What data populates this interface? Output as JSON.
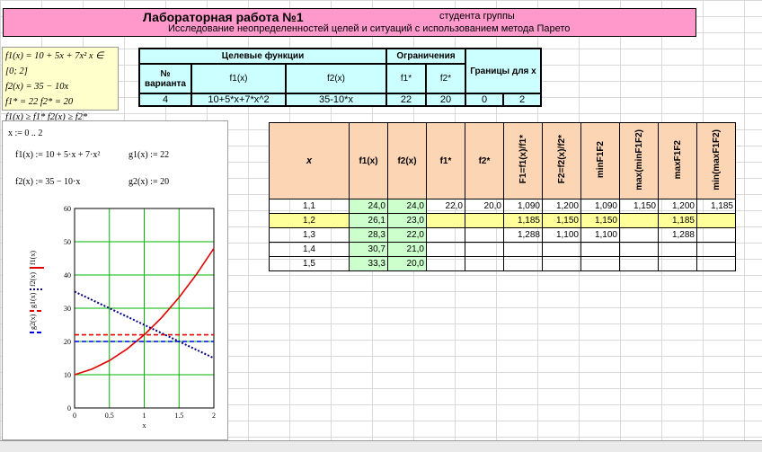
{
  "header": {
    "title": "Лабораторная работа №1",
    "student": "студента группы",
    "subtitle": "Исследование неопределенностей целей и ситуаций с использованием метода Парето"
  },
  "formulas": {
    "line1": "f1(x) = 10 + 5x + 7x²    x ∈ [0; 2]",
    "line2": "f2(x) = 35 − 10x",
    "line3": "f1* = 22    f2* = 20",
    "line4": "f1(x) ≥ f1*    f2(x) ≥ f2*"
  },
  "params": {
    "goal_header": "Целевые функции",
    "constraints_header": "Ограничения",
    "bounds_header": "Границы для x",
    "variant_header": "№ варианта",
    "f1_header": "f1(x)",
    "f2_header": "f2(x)",
    "f1s_header": "f1*",
    "f2s_header": "f2*",
    "variant": "4",
    "f1_formula": "10+5*x+7*x^2",
    "f2_formula": "35-10*x",
    "f1s": "22",
    "f2s": "20",
    "x_from": "0",
    "x_to": "2"
  },
  "mathcad": {
    "range": "x := 0 .. 2",
    "f1_def": "f1(x) := 10 + 5·x + 7·x²",
    "g1_def": "g1(x) := 22",
    "f2_def": "f2(x) := 35 − 10·x",
    "g2_def": "g2(x) := 20",
    "legend": [
      "f1(x)",
      "f2(x)",
      "g1(x)",
      "g2(x)"
    ],
    "xlabel": "x"
  },
  "chart_data": {
    "type": "line",
    "xlim": [
      0,
      2
    ],
    "ylim": [
      0,
      60
    ],
    "x_ticks": [
      "0",
      "0.5",
      "1",
      "1.5",
      "2"
    ],
    "y_ticks": [
      "0",
      "10",
      "20",
      "30",
      "40",
      "50",
      "60"
    ],
    "xlabel": "x",
    "grid": true,
    "series": [
      {
        "name": "f1(x)",
        "color": "#e00000",
        "style": "solid",
        "x": [
          0,
          0.25,
          0.5,
          0.75,
          1,
          1.25,
          1.5,
          1.75,
          2
        ],
        "y": [
          10,
          11.69,
          14.25,
          17.69,
          22,
          27.19,
          33.25,
          40.19,
          48
        ]
      },
      {
        "name": "f2(x)",
        "color": "#000080",
        "style": "dotted",
        "x": [
          0,
          2
        ],
        "y": [
          35,
          15
        ]
      },
      {
        "name": "g1(x)",
        "color": "#e00000",
        "style": "dashed",
        "x": [
          0,
          2
        ],
        "y": [
          22,
          22
        ]
      },
      {
        "name": "g2(x)",
        "color": "#0000e0",
        "style": "dashed",
        "x": [
          0,
          2
        ],
        "y": [
          20,
          20
        ]
      }
    ]
  },
  "table": {
    "headers": [
      "x",
      "f1(x)",
      "f2(x)",
      "f1*",
      "f2*",
      "F1=f1(x)/f1*",
      "F2=f2(x)/f2*",
      "minF1F2",
      "max(minF1F2)",
      "maxF1F2",
      "min(maxF1F2)"
    ],
    "rows": [
      [
        "1,1",
        "24,0",
        "24,0",
        "22,0",
        "20,0",
        "1,090",
        "1,200",
        "1,090",
        "1,150",
        "1,200",
        "1,185"
      ],
      [
        "1,2",
        "26,1",
        "23,0",
        "",
        "",
        "1,185",
        "1,150",
        "1,150",
        "",
        "1,185",
        ""
      ],
      [
        "1,3",
        "28,3",
        "22,0",
        "",
        "",
        "1,288",
        "1,100",
        "1,100",
        "",
        "1,288",
        ""
      ],
      [
        "1,4",
        "30,7",
        "21,0",
        "",
        "",
        "",
        "",
        "",
        "",
        "",
        ""
      ],
      [
        "1,5",
        "33,3",
        "20,0",
        "",
        "",
        "",
        "",
        "",
        "",
        "",
        ""
      ]
    ]
  }
}
